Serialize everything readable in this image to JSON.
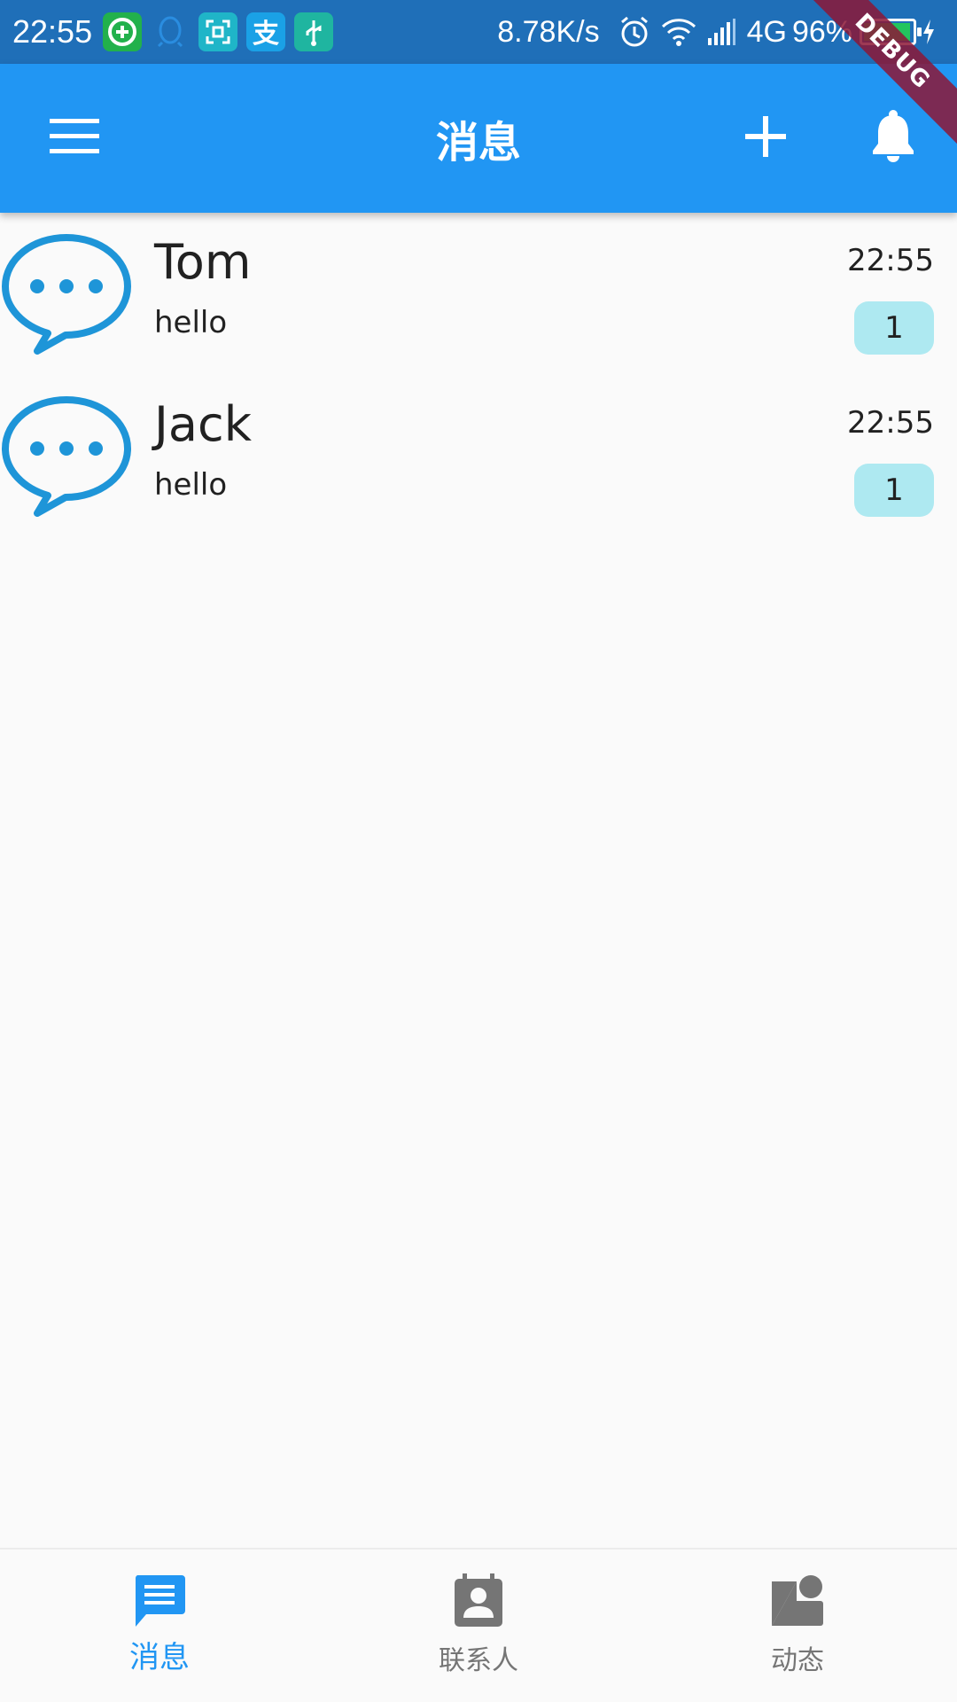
{
  "status_bar": {
    "time": "22:55",
    "net_speed": "8.78K/s",
    "network_type": "4G",
    "battery_percent": "96%",
    "battery_level": 0.96,
    "app_icons": [
      "wechat-plus-icon",
      "qq-icon",
      "scan-icon",
      "alipay-icon",
      "usb-icon"
    ]
  },
  "debug_banner": "DEBUG",
  "app_bar": {
    "title": "消息",
    "menu_icon": "menu-icon",
    "add_icon": "add-icon",
    "bell_icon": "bell-icon"
  },
  "conversations": [
    {
      "name": "Tom",
      "preview": "hello",
      "time": "22:55",
      "unread": "1"
    },
    {
      "name": "Jack",
      "preview": "hello",
      "time": "22:55",
      "unread": "1"
    }
  ],
  "bottom_nav": {
    "items": [
      {
        "label": "消息",
        "icon": "message-icon",
        "active": true
      },
      {
        "label": "联系人",
        "icon": "contacts-icon",
        "active": false
      },
      {
        "label": "动态",
        "icon": "moments-icon",
        "active": false
      }
    ]
  },
  "colors": {
    "primary": "#2196f3",
    "status_bar": "#1f6fb8",
    "badge": "#aee9f1",
    "avatar": "#1e95d8",
    "nav_inactive": "#757575"
  }
}
